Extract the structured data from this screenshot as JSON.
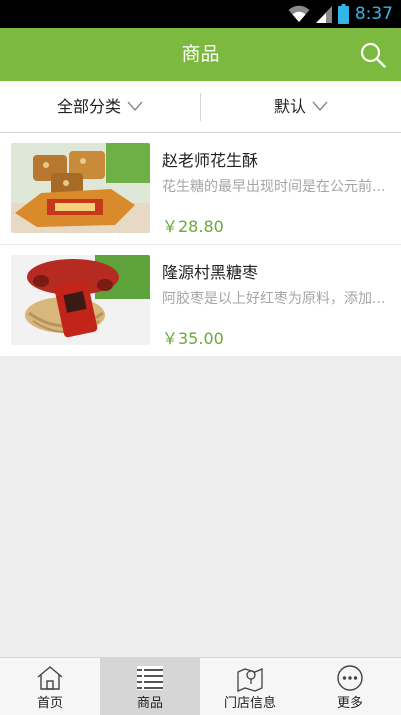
{
  "status_bar": {
    "time": "8:37",
    "icons": [
      "wifi-icon",
      "signal-icon",
      "battery-icon"
    ]
  },
  "header": {
    "title": "商品",
    "search_icon": "search-icon"
  },
  "filters": [
    {
      "label": "全部分类",
      "icon": "chevron-down-icon"
    },
    {
      "label": "默认",
      "icon": "chevron-down-icon"
    }
  ],
  "products": [
    {
      "name": "赵老师花生酥",
      "description": "花生糖的最早出现时间是在公元前...",
      "price": "￥28.80"
    },
    {
      "name": "隆源村黑糖枣",
      "description": "阿胶枣是以上好红枣为原料，添加...",
      "price": "￥35.00"
    }
  ],
  "tabs": [
    {
      "label": "首页",
      "icon": "home-icon",
      "active": false
    },
    {
      "label": "商品",
      "icon": "list-icon",
      "active": true
    },
    {
      "label": "门店信息",
      "icon": "map-icon",
      "active": false
    },
    {
      "label": "更多",
      "icon": "more-icon",
      "active": false
    }
  ],
  "colors": {
    "accent": "#7bb93f",
    "price": "#6aa83a",
    "status_time": "#33b5e5"
  }
}
